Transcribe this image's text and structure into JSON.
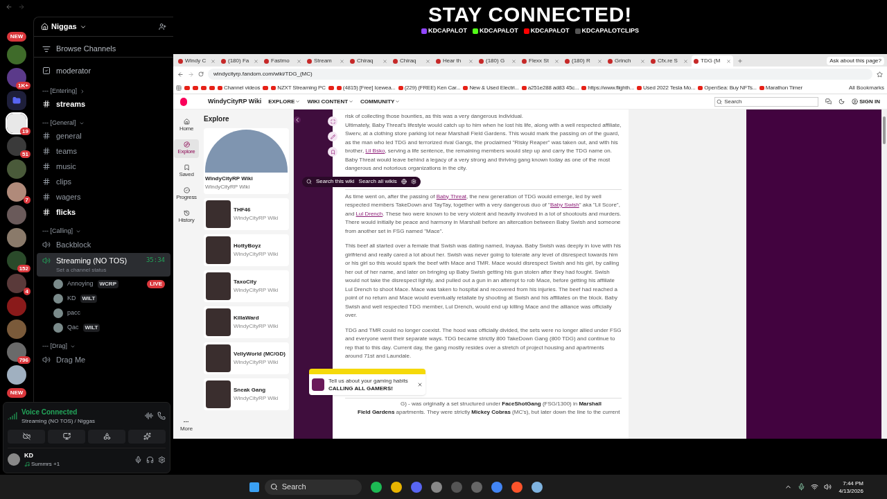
{
  "overlay": {
    "title": "STAY CONNECTED!",
    "socials": [
      {
        "kind": "twitch",
        "handle": "KDCAPALOT"
      },
      {
        "kind": "kick",
        "handle": "KDCAPALOT"
      },
      {
        "kind": "youtube",
        "handle": "KDCAPALOT"
      },
      {
        "kind": "tiktok",
        "handle": "KDCAPALOTCLIPS"
      }
    ]
  },
  "discord": {
    "rail": [
      {
        "kind": "new",
        "label": "NEW"
      },
      {
        "kind": "server",
        "color": "#3f6b2a",
        "selected": false
      },
      {
        "kind": "server",
        "color": "#5b3a8a",
        "badge": "1K+",
        "selected": false
      },
      {
        "kind": "folder"
      },
      {
        "kind": "server",
        "color": "#e8e8e8",
        "badge": "19",
        "selected": true
      },
      {
        "kind": "server",
        "color": "#3a3a3a",
        "badge": "51",
        "selected": false
      },
      {
        "kind": "server",
        "color": "#4a5a3a",
        "selected": false
      },
      {
        "kind": "server",
        "color": "#b08a7a",
        "badge": "7",
        "selected": false
      },
      {
        "kind": "server",
        "color": "#6a5a5a",
        "selected": false
      },
      {
        "kind": "server",
        "color": "#8a7a6a",
        "selected": false
      },
      {
        "kind": "server",
        "color": "#2a4a2a",
        "badge": "152",
        "selected": false
      },
      {
        "kind": "server",
        "color": "#5a3a3a",
        "badge": "4",
        "selected": false
      },
      {
        "kind": "server",
        "color": "#8a1a1a",
        "selected": false
      },
      {
        "kind": "server",
        "color": "#7a5a3a",
        "selected": false
      },
      {
        "kind": "server",
        "color": "#6a6a6a",
        "badge": "796",
        "selected": false
      },
      {
        "kind": "server",
        "color": "#a0b0c0",
        "selected": false
      },
      {
        "kind": "new",
        "label": "NEW"
      }
    ],
    "server_name": "Niggas",
    "channels": [
      {
        "kind": "browse",
        "name": "Browse Channels"
      },
      {
        "kind": "moderator",
        "name": "moderator"
      },
      {
        "kind": "category",
        "name": "--- [Entering]",
        "expanded": false
      },
      {
        "kind": "text",
        "name": "streams",
        "unread": true
      },
      {
        "kind": "category",
        "name": "--- [General]",
        "expanded": true
      },
      {
        "kind": "text",
        "name": "general",
        "unread": false
      },
      {
        "kind": "text",
        "name": "teams",
        "unread": false
      },
      {
        "kind": "text",
        "name": "music",
        "unread": false
      },
      {
        "kind": "text",
        "name": "clips",
        "unread": false
      },
      {
        "kind": "text",
        "name": "wagers",
        "unread": false
      },
      {
        "kind": "text",
        "name": "flicks",
        "unread": true
      },
      {
        "kind": "category",
        "name": "--- [Calling]",
        "expanded": true
      },
      {
        "kind": "voice",
        "name": "Backblock",
        "selected": false
      },
      {
        "kind": "voice",
        "name": "Streaming (NO TOS)",
        "selected": true,
        "timer": "35:34",
        "status": "Set a channel status",
        "members": [
          {
            "name": "Annoying",
            "tag": "WCRP",
            "live": "LIVE"
          },
          {
            "name": "KD",
            "tag": "WILT"
          },
          {
            "name": "pacc"
          },
          {
            "name": "Qac",
            "tag": "WILT"
          }
        ]
      },
      {
        "kind": "category",
        "name": "--- [Drag]",
        "expanded": true
      },
      {
        "kind": "voice",
        "name": "Drag Me",
        "selected": false
      }
    ],
    "voice": {
      "title": "Voice Connected",
      "location": "Streaming (NO TOS) / Niggas"
    },
    "user": {
      "name": "KD",
      "activity": "Summrs +1"
    }
  },
  "browser": {
    "tabs": [
      {
        "label": "Windy C",
        "selected": false
      },
      {
        "label": "(180) Fa",
        "selected": false
      },
      {
        "label": "Fastmo",
        "selected": false
      },
      {
        "label": "Stream",
        "selected": false
      },
      {
        "label": "Chiraq",
        "selected": false
      },
      {
        "label": "Chiraq",
        "selected": false
      },
      {
        "label": "Hear th",
        "selected": false
      },
      {
        "label": "(180) G",
        "selected": false
      },
      {
        "label": "Flexx St",
        "selected": false
      },
      {
        "label": "(180) R",
        "selected": false
      },
      {
        "label": "Grinch",
        "selected": false
      },
      {
        "label": "Cfx.re S",
        "selected": false
      },
      {
        "label": "TDG (M",
        "selected": true
      }
    ],
    "ask": "Ask about this page?",
    "url": "windycityrp.fandom.com/wiki/TDG_(MC)",
    "bookmarks": [
      {
        "kind": "icon"
      },
      {
        "kind": "icon"
      },
      {
        "kind": "icon"
      },
      {
        "kind": "icon"
      },
      {
        "kind": "labeled",
        "label": "Channel videos"
      },
      {
        "kind": "icon"
      },
      {
        "kind": "labeled",
        "label": "NZXT Streaming PC"
      },
      {
        "kind": "icon"
      },
      {
        "kind": "labeled",
        "label": "(4815) [Free] Icewea..."
      },
      {
        "kind": "labeled",
        "label": "(229) (FREE) Ken Car..."
      },
      {
        "kind": "labeled",
        "label": "New & Used Electri..."
      },
      {
        "kind": "labeled",
        "label": "a251e288 ad83 45c..."
      },
      {
        "kind": "labeled",
        "label": "https://www.flighth..."
      },
      {
        "kind": "labeled",
        "label": "Used 2022 Tesla Mo..."
      },
      {
        "kind": "labeled",
        "label": "OpenSea: Buy NFTs..."
      },
      {
        "kind": "labeled",
        "label": "Marathon Timer"
      }
    ],
    "all_bookmarks": "All Bookmarks"
  },
  "wiki": {
    "name": "WindyCityRP Wiki",
    "nav": [
      "EXPLORE",
      "WIKI CONTENT",
      "COMMUNITY"
    ],
    "search": {
      "placeholder": "Search"
    },
    "sign_in": "SIGN IN",
    "rail": [
      {
        "kind": "home",
        "label": "Home",
        "selected": false
      },
      {
        "kind": "explore",
        "label": "Explore",
        "selected": true
      },
      {
        "kind": "saved",
        "label": "Saved",
        "selected": false
      },
      {
        "kind": "progress",
        "label": "Progress",
        "selected": false
      },
      {
        "kind": "history",
        "label": "History",
        "selected": false
      }
    ],
    "more": "More",
    "explore": {
      "title": "Explore",
      "cards": [
        {
          "kind": "featured",
          "title": "WindyCityRP Wiki",
          "subtitle": "WindyCityRP Wiki"
        },
        {
          "kind": "item",
          "title": "THF46",
          "subtitle": "WindyCityRP Wiki"
        },
        {
          "kind": "item",
          "title": "HottyBoyz",
          "subtitle": "WindyCityRP Wiki"
        },
        {
          "kind": "item",
          "title": "TaxoCity",
          "subtitle": "WindyCityRP Wiki"
        },
        {
          "kind": "item",
          "title": "KillaWard",
          "subtitle": "WindyCityRP Wiki"
        },
        {
          "kind": "item",
          "title": "VellyWorld (MC/GD)",
          "subtitle": "WindyCityRP Wiki"
        },
        {
          "kind": "item",
          "title": "Sneak Gang",
          "subtitle": "WindyCityRP Wiki"
        }
      ]
    },
    "search_bar": {
      "this": "Search this wiki",
      "all": "Search all wikis"
    },
    "article": [
      [
        {
          "kind": "text",
          "text": "risk of collecting those bounties, as this was a very dangerous individual."
        },
        {
          "kind": "break"
        },
        {
          "kind": "text",
          "text": "Ultimately, Baby Threat's lifestyle would catch up to him when he lost his life, along with a well respected affiliate, Swerv, at a clothing store parking lot near Marshall Field Gardens. This would mark the passing on of the guard, as the man who led TDG and terrorized rival Gangs, the proclaimed \"Risky Reaper\" was taken out, and with his brother, "
        },
        {
          "kind": "link",
          "text": "Lil Bsko"
        },
        {
          "kind": "text",
          "text": ", serving a life sentence, the remaining members would step up and carry the TDG name on. Baby Threat would leave behind a legacy of a very strong and thriving gang known today as one of the most dangerous and notorious organizations in the city."
        }
      ],
      [
        {
          "kind": "text",
          "text": "As time went on, after the passing of "
        },
        {
          "kind": "link",
          "text": "Baby Threat"
        },
        {
          "kind": "text",
          "text": ", the new generation of TDG would emerge, led by well respected members TakeDown and TayTay, together with a very dangerous duo of \""
        },
        {
          "kind": "link",
          "text": "Baby Swish"
        },
        {
          "kind": "text",
          "text": "\" aka \"Lil Score\", and "
        },
        {
          "kind": "link",
          "text": "Lul Drench"
        },
        {
          "kind": "text",
          "text": ". These two were known to be very violent and heavily involved in a lot of shootouts and murders. There would initially be peace and harmony in Marshall before an altercation between Baby Swish and someone from another set in FSG named \"Mace\"."
        }
      ],
      [
        {
          "kind": "text",
          "text": "This beef all started over a female that Swish was dating named, Inayaa. Baby Swish was deeply in love with his girlfriend and really cared a lot about her. Swish was never going to tolerate any level of disrespect towards him or his girl so this would spark the beef with Mace and TMR. Mace would disrespect Swish and his girl, by calling her out of her name, and later on bringing up Baby Swish getting his gun stolen after they had fought. Swish would not take the disrespect lightly, and pulled out a gun in an attempt to rob Mace, before getting his affiliate Lul Drench to shoot Mace. Mace was taken to hospital and recovered from his injuries. The beef had reached a point of no return and Mace would eventually retaliate by shooting at Swish and his affiliates on the block. Baby Swish and well respected TDG member, Lul Drench, would end up killing Mace and the alliance was officially over."
        }
      ],
      [
        {
          "kind": "text",
          "text": "TDG and TMR could no longer coexist. The hood was officially divided, the sets were no longer allied under FSG and everyone went their separate ways. TDG became strictly 800 TakeDown Gang (800 TDG) and continue to rep that to this day. Current day, the gang mostly resides over a stretch of project housing and apartments around 71st and Laundale."
        }
      ]
    ],
    "article_tail": [
      {
        "kind": "text",
        "text": "G) - was originally a set structured under "
      },
      {
        "kind": "bold",
        "text": "FaceShotGang"
      },
      {
        "kind": "text",
        "text": " (FSG/1300) in "
      },
      {
        "kind": "bold",
        "text": "Marshall"
      }
    ],
    "article_tail2": [
      {
        "kind": "bold",
        "text": "Field Gardens"
      },
      {
        "kind": "text",
        "text": " apartments. They were strictly "
      },
      {
        "kind": "bold",
        "text": "Mickey Cobras"
      },
      {
        "kind": "text",
        "text": " (MC's), but later down the line to the current"
      }
    ],
    "popup": {
      "text": "Tell us about your gaming habits",
      "title": "CALLING ALL GAMERS!"
    }
  },
  "taskbar": {
    "search": "Search",
    "time": "7:44 PM",
    "date": "4/13/2026"
  }
}
